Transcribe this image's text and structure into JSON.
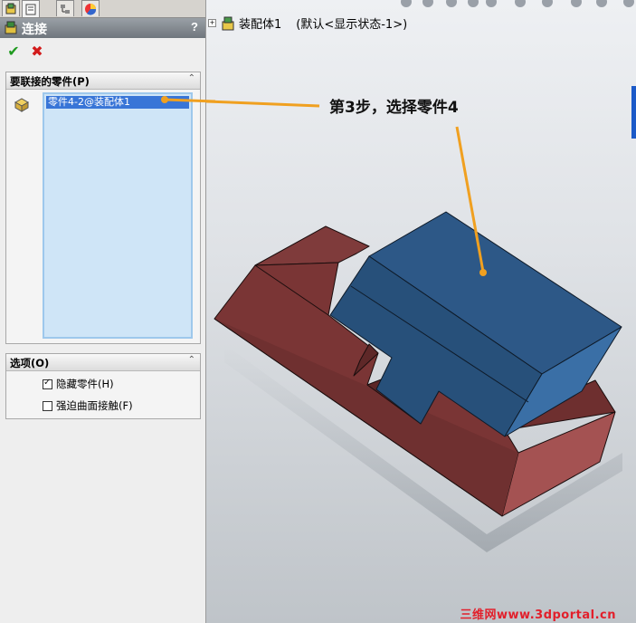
{
  "property_manager": {
    "title": "连接",
    "help": "?",
    "group_components": {
      "header": "要联接的零件(P)",
      "items": [
        "零件4-2@装配体1"
      ]
    },
    "group_options": {
      "header": "选项(O)",
      "hide_parts": {
        "label": "隐藏零件(H)",
        "checked": true
      },
      "force_surface": {
        "label": "强迫曲面接触(F)",
        "checked": false
      }
    }
  },
  "feature_tree": {
    "expand": "+",
    "root": "装配体1",
    "state": "(默认<显示状态-1>)"
  },
  "annotation": "第3步，选择零件4",
  "watermark": "三维网www.3dportal.cn",
  "colors": {
    "red_part": "#7a3535",
    "blue_part": "#2e5a85",
    "callout": "#f0a020",
    "selection": "#3875d7"
  }
}
